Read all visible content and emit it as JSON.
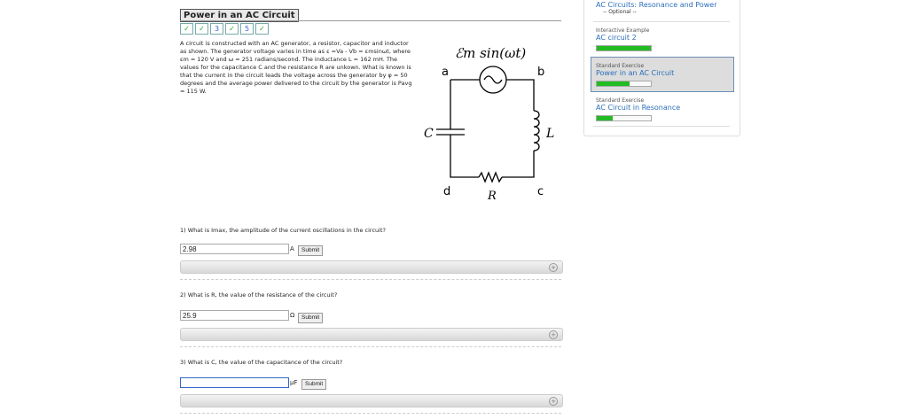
{
  "title": "Power in an AC Circuit",
  "parts": [
    {
      "type": "check",
      "label": "✓"
    },
    {
      "type": "check",
      "label": "✓"
    },
    {
      "type": "num",
      "label": "3"
    },
    {
      "type": "check",
      "label": "✓"
    },
    {
      "type": "num",
      "label": "5"
    },
    {
      "type": "check",
      "label": "✓"
    }
  ],
  "problem": "A circuit is constructed with an AC generator, a resistor, capacitor and inductor as shown. The generator voltage varies in time as ε =Va - Vb = εmsinωt, where εm = 120 V and ω = 251 radians/second. The inductance L = 162 mH. The values for the capacitance C and the resistance R are unkown. What is known is that the current in the circuit leads the voltage across the generator by φ = 50 degrees and the average power delivered to the circuit by the generator is Pavg = 115 W.",
  "diagram": {
    "source": "ℰm sin(ωt)",
    "a": "a",
    "b": "b",
    "c": "c",
    "d": "d",
    "C": "C",
    "L": "L",
    "R": "R"
  },
  "questions": [
    {
      "text": "1) What is Imax, the amplitude of the current oscillations in the circuit?",
      "value": "2.98",
      "unit": "A",
      "submit": "Submit"
    },
    {
      "text": "2) What is R, the value of the resistance of the circuit?",
      "value": "25.9",
      "unit": "Ω",
      "submit": "Submit"
    },
    {
      "text": "3) What is C, the value of the capacitance of the circuit?",
      "value": "",
      "unit": "μF",
      "submit": "Submit"
    }
  ],
  "sidebar": {
    "worked": {
      "link": "AC Circuits: Resonance and Power",
      "sub": "-- Optional --"
    },
    "items": [
      {
        "type": "Interactive Example",
        "link": "AC circuit 2",
        "progress": 100
      },
      {
        "type": "Standard Exercise",
        "link": "Power in an AC Circuit",
        "progress": 60
      },
      {
        "type": "Standard Exercise",
        "link": "AC Circuit in Resonance",
        "progress": 30
      }
    ]
  }
}
